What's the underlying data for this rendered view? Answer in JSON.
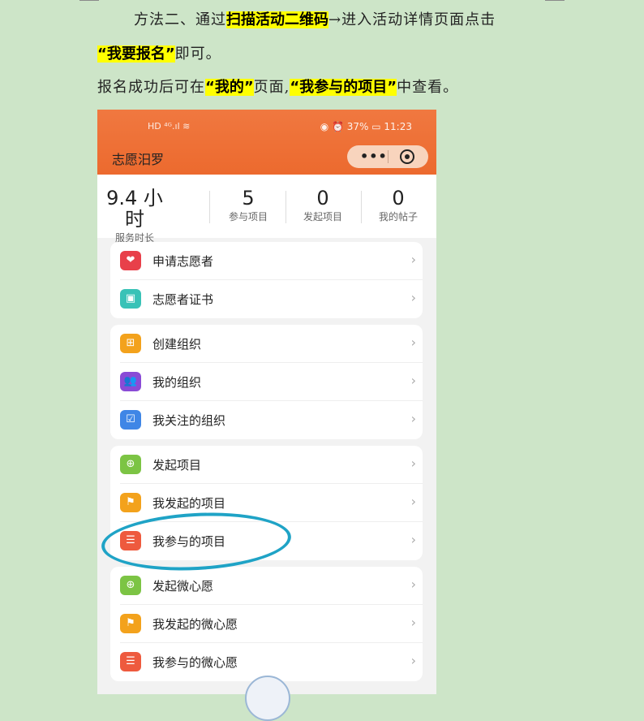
{
  "doc": {
    "line1": {
      "p1": "方法二、通过",
      "hl": "扫描活动二维码",
      "p2": "→进入活动详情页面点击"
    },
    "line2": {
      "hl": "“我要报名”",
      "p2": "即可。"
    },
    "line3": {
      "p1": "报名成功后可在",
      "hl1": "“我的”",
      "p2": "页面,",
      "hl2": "“我参与的项目”",
      "p3": "中查看。"
    }
  },
  "phone": {
    "status_left": "HD ⁴ᴳ.ıl ≋",
    "status_right": "◉ ⏰ 37% ▭ 11:23",
    "app_title": "志愿汨罗",
    "capsule_dots": "•••",
    "stats": [
      {
        "value": "9.4 小时",
        "label": "服务时长"
      },
      {
        "value": "5",
        "label": "参与项目"
      },
      {
        "value": "0",
        "label": "发起项目"
      },
      {
        "value": "0",
        "label": "我的帖子"
      }
    ],
    "groups": [
      [
        {
          "label": "申请志愿者",
          "icon": "heart-icon",
          "color": "#e8404a",
          "glyph": "❤"
        },
        {
          "label": "志愿者证书",
          "icon": "certificate-icon",
          "color": "#39c2b7",
          "glyph": "▣"
        }
      ],
      [
        {
          "label": "创建组织",
          "icon": "create-org-icon",
          "color": "#f3a21c",
          "glyph": "⊞"
        },
        {
          "label": "我的组织",
          "icon": "group-icon",
          "color": "#8a4bd6",
          "glyph": "👥"
        },
        {
          "label": "我关注的组织",
          "icon": "follow-icon",
          "color": "#3f86e6",
          "glyph": "☑"
        }
      ],
      [
        {
          "label": "发起项目",
          "icon": "plus-icon",
          "color": "#7cc444",
          "glyph": "⊕"
        },
        {
          "label": "我发起的项目",
          "icon": "flag-icon",
          "color": "#f3a21c",
          "glyph": "⚑"
        },
        {
          "label": "我参与的项目",
          "icon": "list-icon",
          "color": "#ee5a3e",
          "glyph": "☰"
        }
      ],
      [
        {
          "label": "发起微心愿",
          "icon": "plus-icon",
          "color": "#7cc444",
          "glyph": "⊕"
        },
        {
          "label": "我发起的微心愿",
          "icon": "flag-icon",
          "color": "#f3a21c",
          "glyph": "⚑"
        },
        {
          "label": "我参与的微心愿",
          "icon": "list-icon",
          "color": "#ee5a3e",
          "glyph": "☰"
        }
      ]
    ],
    "chevron": "›"
  }
}
